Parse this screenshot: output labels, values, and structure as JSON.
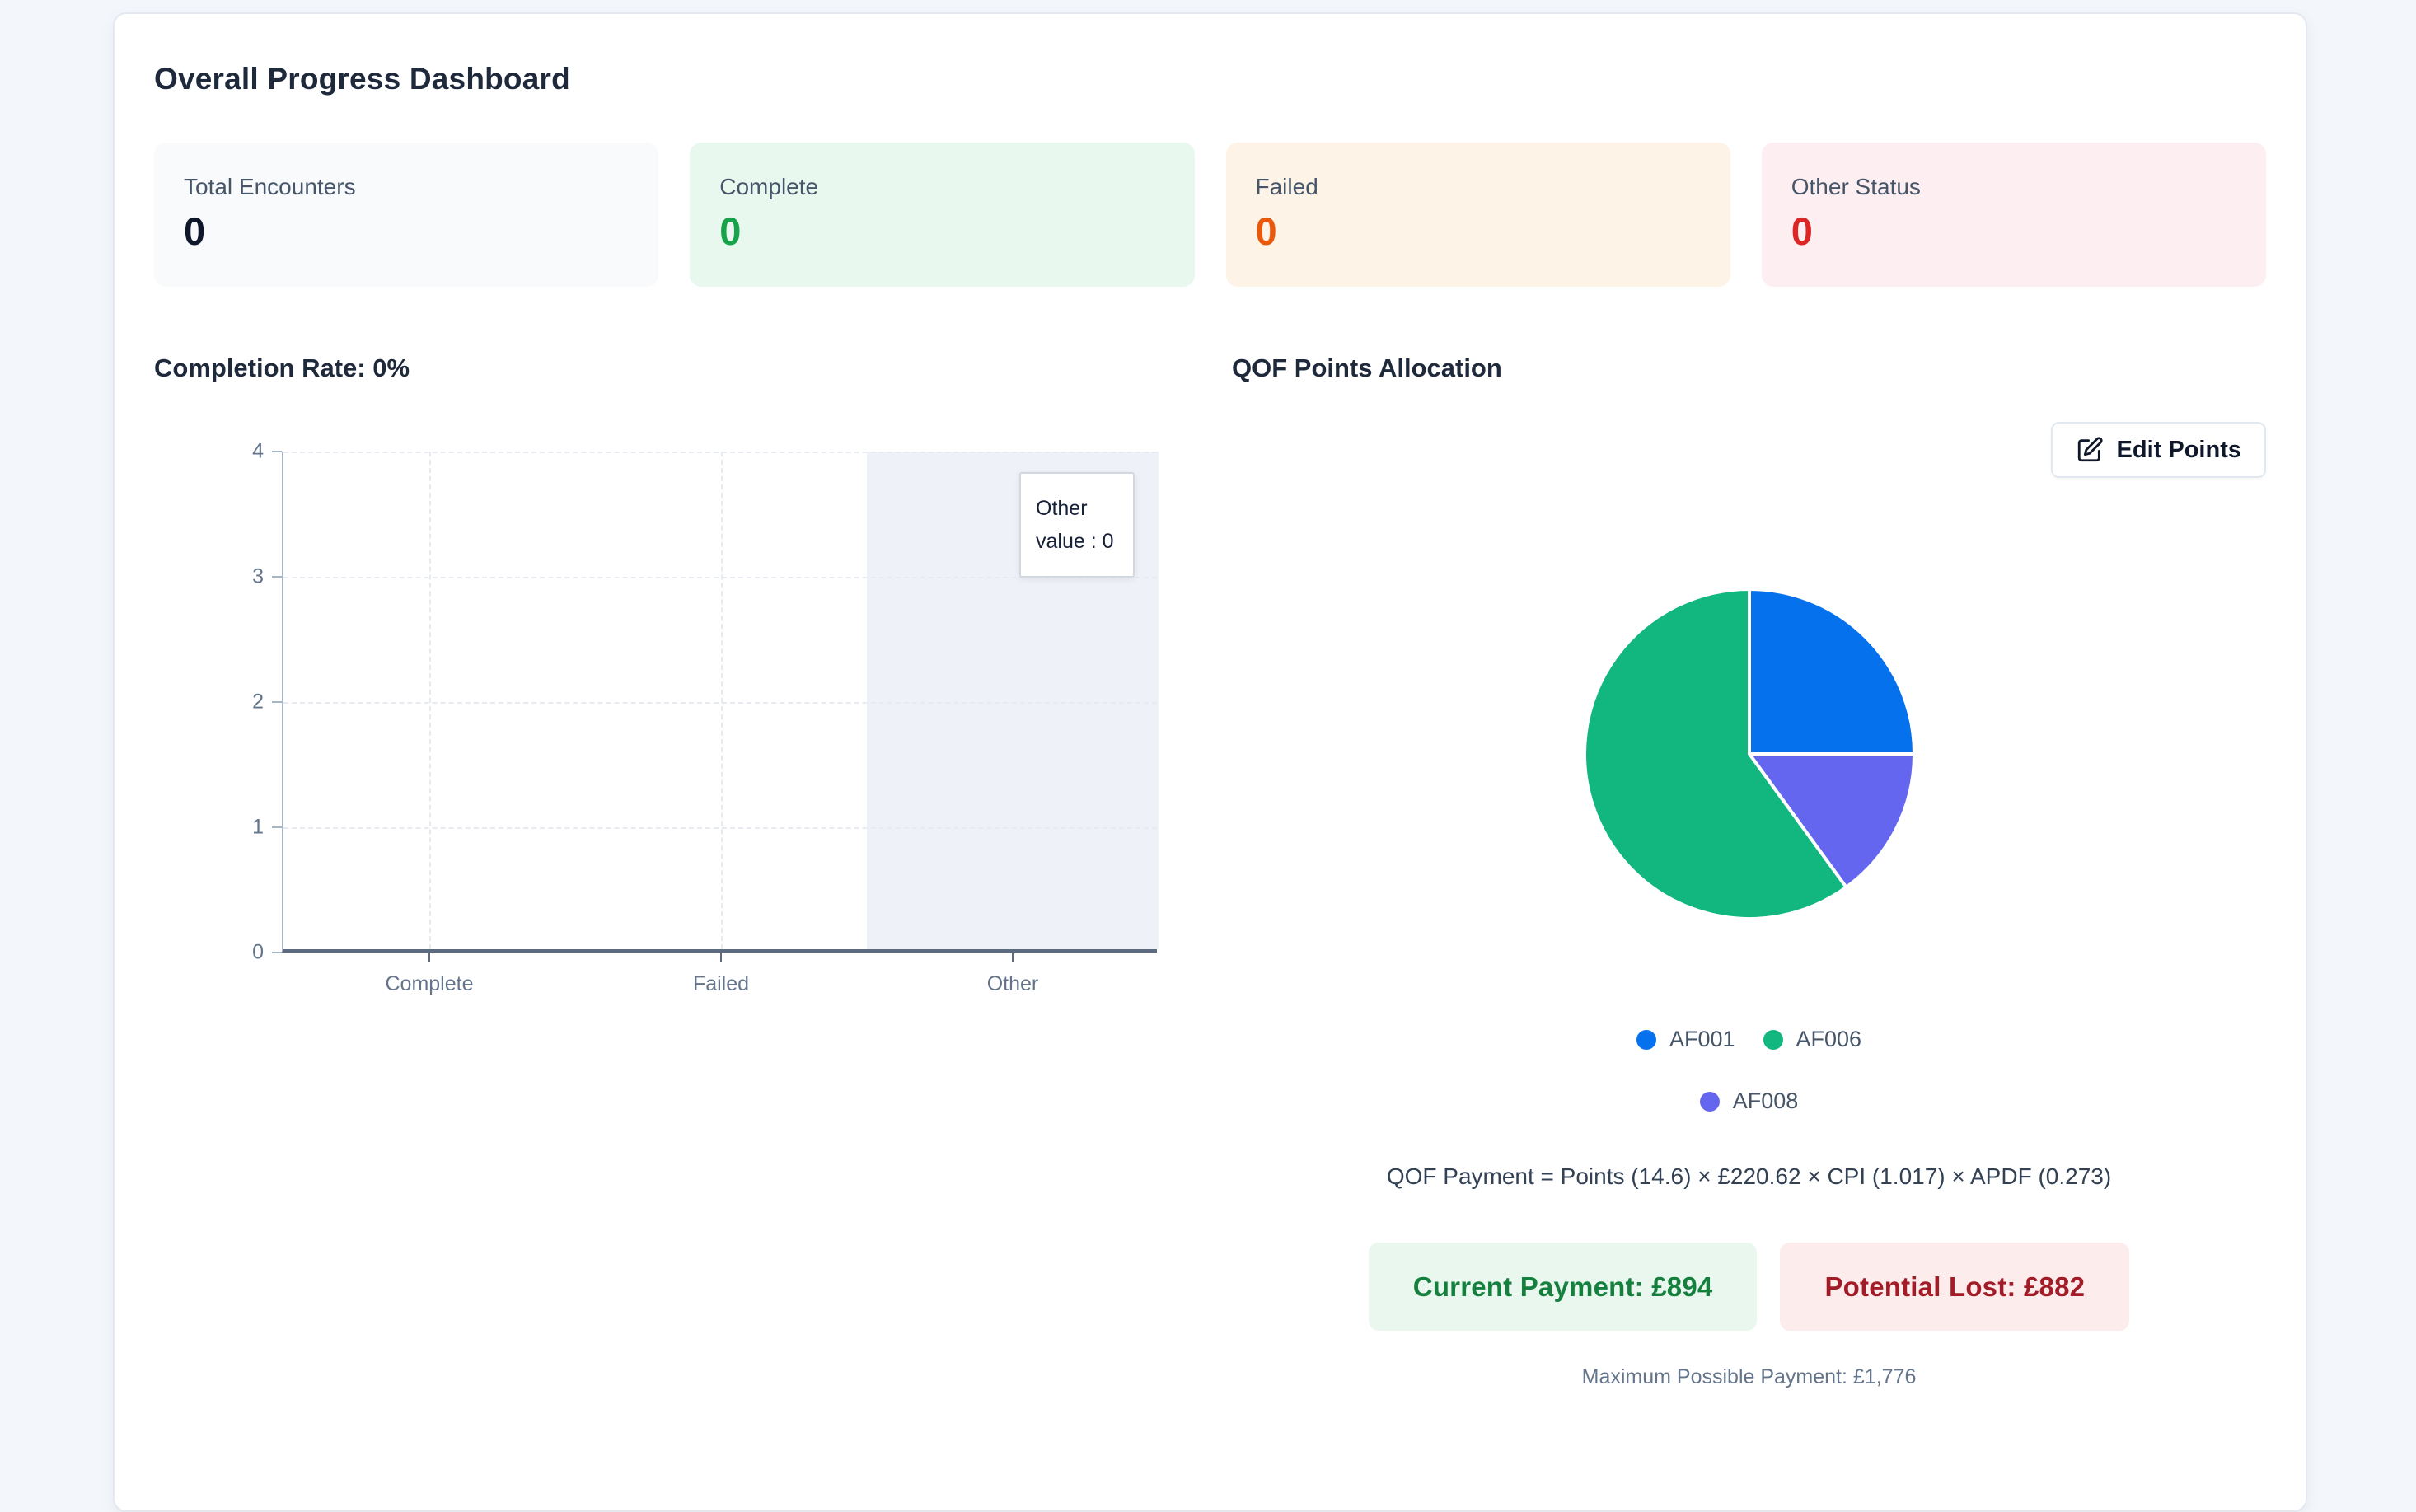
{
  "page": {
    "title": "Overall Progress Dashboard"
  },
  "stats": [
    {
      "label": "Total Encounters",
      "value": "0",
      "bg": "#f8fafc",
      "color": "#0f172a"
    },
    {
      "label": "Complete",
      "value": "0",
      "bg": "#e9f8ef",
      "color": "#16a34a"
    },
    {
      "label": "Failed",
      "value": "0",
      "bg": "#fdf3e7",
      "color": "#ea580c"
    },
    {
      "label": "Other Status",
      "value": "0",
      "bg": "#fdeef1",
      "color": "#dc2626"
    }
  ],
  "completion": {
    "heading": "Completion Rate: 0%"
  },
  "qof": {
    "heading": "QOF Points Allocation",
    "edit_button_label": "Edit Points",
    "formula": "QOF Payment = Points (14.6) × £220.62 × CPI (1.017) × APDF (0.273)",
    "current_payment": "Current Payment: £894",
    "potential_lost": "Potential Lost: £882",
    "max_payment": "Maximum Possible Payment: £1,776"
  },
  "chart_data": [
    {
      "type": "bar",
      "title": "Completion Rate: 0%",
      "categories": [
        "Complete",
        "Failed",
        "Other"
      ],
      "values": [
        0,
        0,
        0
      ],
      "xlabel": "",
      "ylabel": "",
      "ylim": [
        0,
        4
      ],
      "yticks": [
        0,
        1,
        2,
        3,
        4
      ],
      "grid": true,
      "bar_color": "#0571ed",
      "highlighted_category": "Other",
      "highlight_color": "#eef1f7",
      "tooltip": {
        "title": "Other",
        "line": "value : 0"
      }
    },
    {
      "type": "pie",
      "title": "QOF Points Allocation",
      "slices": [
        {
          "label": "AF001",
          "percent": 25,
          "color": "#0571ed"
        },
        {
          "label": "AF008",
          "percent": 15,
          "color": "#6466f0"
        },
        {
          "label": "AF006",
          "percent": 60,
          "color": "#11b77f"
        }
      ],
      "legend": [
        "AF001",
        "AF006",
        "AF008"
      ],
      "legend_position": "bottom",
      "start_angle_deg": 0,
      "direction": "clockwise"
    }
  ]
}
